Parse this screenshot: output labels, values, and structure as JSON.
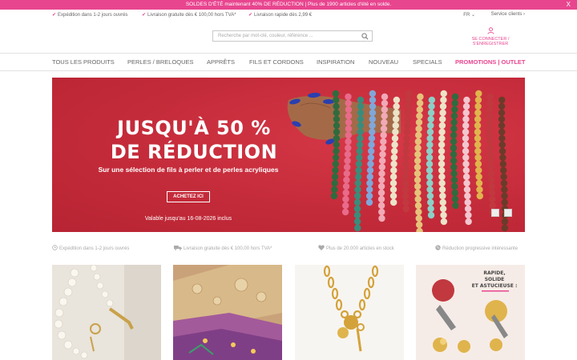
{
  "topbar": {
    "message": "SOLDES D'ÉTÉ maintenant 40% DE RÉDUCTION | Plus de 1900 articles d'été en solde.",
    "close_label": "X"
  },
  "usp_bar": {
    "items": [
      "Expédition dans 1-2 jours ouvrés",
      "Livraison gratuite dès € 100,00 hors TVA*",
      "Livraison rapide dès 2,99 €"
    ],
    "language": "FR",
    "service": "Service clients"
  },
  "search": {
    "placeholder": "Recherche par mot-clé, couleur, référence ..."
  },
  "account": {
    "label": "SE CONNECTER / S'ENREGISTRER"
  },
  "nav": {
    "items": [
      "TOUS LES PRODUITS",
      "PERLES / BRELOQUES",
      "APPRÊTS",
      "FILS ET CORDONS",
      "INSPIRATION",
      "NOUVEAU",
      "SPECIALS"
    ],
    "promo": "PROMOTIONS | OUTLET"
  },
  "hero": {
    "headline_1": "JUSQU'À 50 %",
    "headline_2": "DE RÉDUCTION",
    "subtitle": "Sur une sélection de fils à perler et de perles acryliques",
    "cta": "ACHETEZ ICI",
    "validity": "Valable jusqu'au 16-08-2026 inclus",
    "colors": {
      "background": "#c42b3a",
      "accent": "#e8458f"
    }
  },
  "usp_bottom": {
    "items": [
      "Expédition dans 1-2 jours ouvrés",
      "Livraison gratuite dès € 100,00 hors TVA*",
      "Plus de 20.000 articles en stock",
      "Réduction progressive intéressante"
    ]
  },
  "tiles": {
    "tile4_title_1": "RAPIDE,",
    "tile4_title_2": "SOLIDE",
    "tile4_title_3": "ET ASTUCIEUSE :"
  }
}
